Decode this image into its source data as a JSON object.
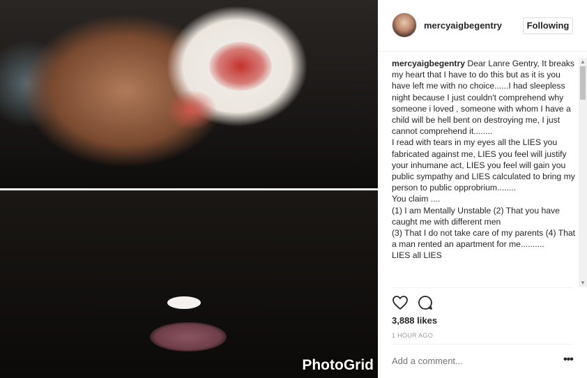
{
  "photo": {
    "watermark": "PhotoGrid"
  },
  "post": {
    "username": "mercyaigbegentry",
    "follow_label": "Following",
    "caption_user": "mercyaigbegentry",
    "caption_text": " Dear Lanre Gentry, It breaks my heart that I have to do this but as it is you have left me with no choice......I had sleepless night because I just couldn't comprehend why someone i loved , someone with whom I have a child will be hell bent on destroying me, I just cannot comprehend it........\nI read with tears in my eyes all the LIES you fabricated against me, LIES you feel will justify your inhumane act, LIES you feel will gain you public sympathy and LIES calculated to bring my person to public opprobrium........\nYou claim ....\n(1) I am Mentally Unstable (2) That you have caught me with different men\n(3) That I do not take care of my parents (4) That a man rented an apartment for me..........\nLIES all LIES",
    "likes": "3,888 likes",
    "time": "1 HOUR AGO",
    "comment_placeholder": "Add a comment...",
    "more_label": "•••"
  },
  "icons": {
    "like": "heart-icon",
    "comment": "comment-icon"
  }
}
